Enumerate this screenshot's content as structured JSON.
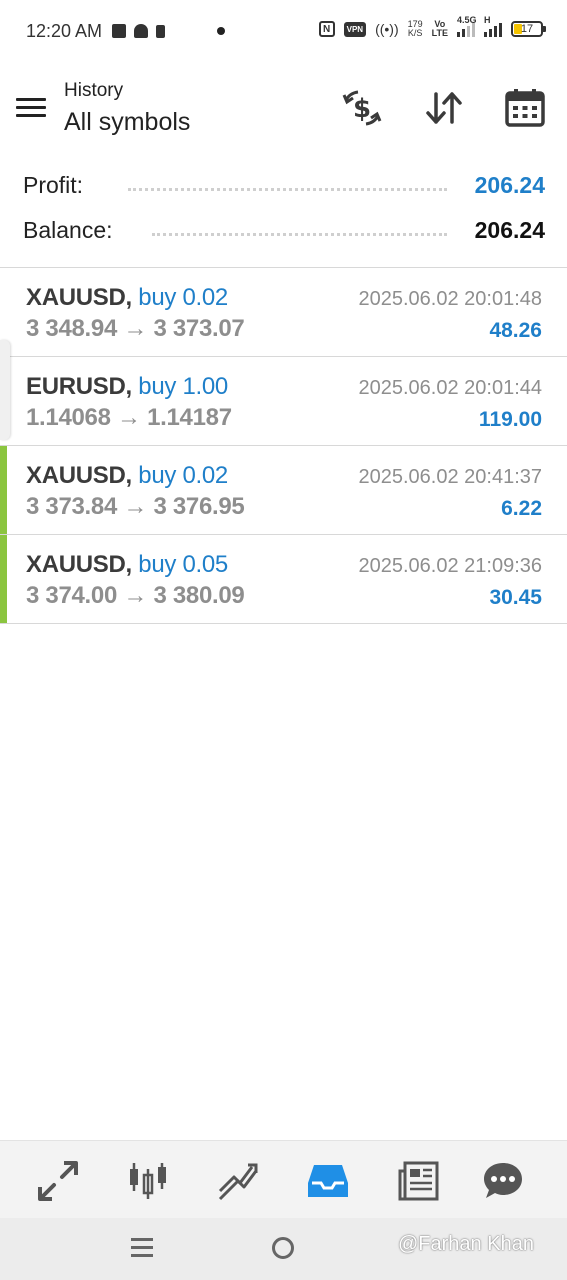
{
  "status_bar": {
    "time": "12:20 AM",
    "nfc": "N",
    "vpn": "VPN",
    "network_speed": "179",
    "network_speed_unit": "K/S",
    "volte_1": "Vo",
    "volte_2": "LTE",
    "signal_label_1": "4.5G",
    "signal_label_2": "H",
    "battery": "17",
    "battery_color": "#f5c400"
  },
  "header": {
    "subtitle": "History",
    "title": "All symbols",
    "icons": [
      "menu-icon",
      "dollar-refresh-icon",
      "sort-arrows-icon",
      "calendar-icon"
    ]
  },
  "summary": {
    "profit_label": "Profit:",
    "profit_value": "206.24",
    "balance_label": "Balance:",
    "balance_value": "206.24"
  },
  "deals": [
    {
      "symbol": "XAUUSD,",
      "side": "buy 0.02",
      "prices": "3 348.94 → 3 373.07",
      "time": "2025.06.02 20:01:48",
      "profit": "48.26",
      "marker": false
    },
    {
      "symbol": "EURUSD,",
      "side": "buy 1.00",
      "prices": "1.14068 → 1.14187",
      "time": "2025.06.02 20:01:44",
      "profit": "119.00",
      "marker": false
    },
    {
      "symbol": "XAUUSD,",
      "side": "buy 0.02",
      "prices": "3 373.84 → 3 376.95",
      "time": "2025.06.02 20:41:37",
      "profit": "6.22",
      "marker": true
    },
    {
      "symbol": "XAUUSD,",
      "side": "buy 0.05",
      "prices": "3 374.00 → 3 380.09",
      "time": "2025.06.02 21:09:36",
      "profit": "30.45",
      "marker": true
    }
  ],
  "bottom_nav": {
    "items": [
      "quotes-icon",
      "chart-icon",
      "trade-icon",
      "history-icon",
      "news-icon",
      "chat-icon"
    ],
    "active": "history-icon",
    "active_color": "#1f8fe6"
  },
  "system_nav": {
    "watermark": "@Farhan Khan"
  },
  "colors": {
    "accent": "#1f7fc9",
    "marker": "#8bc53f"
  }
}
